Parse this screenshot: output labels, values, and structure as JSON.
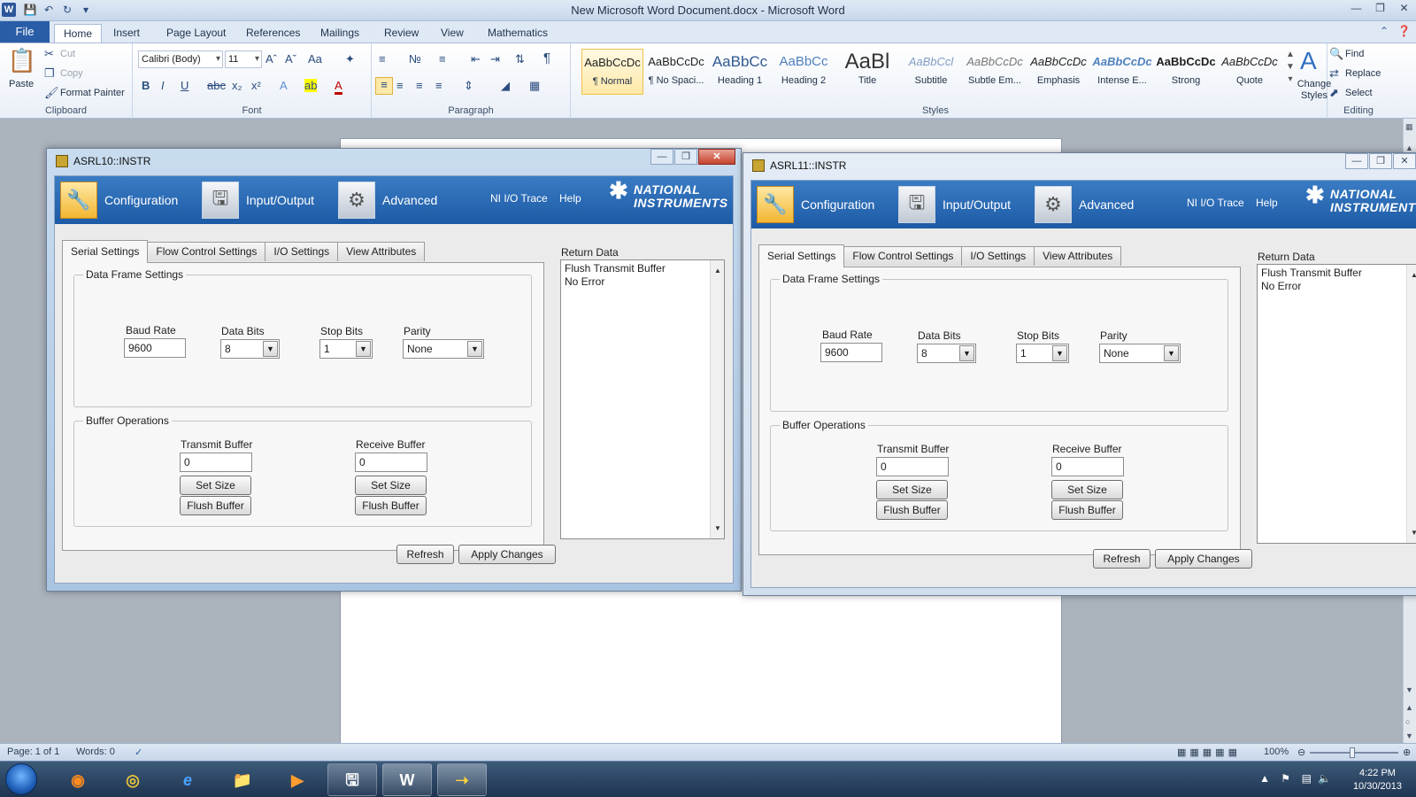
{
  "word": {
    "title": "New Microsoft Word Document.docx - Microsoft Word",
    "tabs": [
      "File",
      "Home",
      "Insert",
      "Page Layout",
      "References",
      "Mailings",
      "Review",
      "View",
      "Mathematics"
    ],
    "clipboard": {
      "paste": "Paste",
      "cut": "Cut",
      "copy": "Copy",
      "format_painter": "Format Painter",
      "label": "Clipboard"
    },
    "font": {
      "name": "Calibri (Body)",
      "size": "11",
      "label": "Font"
    },
    "paragraph": {
      "label": "Paragraph"
    },
    "styles": {
      "label": "Styles",
      "items": [
        {
          "preview": "AaBbCcDc",
          "name": "¶ Normal"
        },
        {
          "preview": "AaBbCcDc",
          "name": "¶ No Spaci..."
        },
        {
          "preview": "AaBbCc",
          "name": "Heading 1"
        },
        {
          "preview": "AaBbCc",
          "name": "Heading 2"
        },
        {
          "preview": "AaBl",
          "name": "Title"
        },
        {
          "preview": "AaBbCcl",
          "name": "Subtitle"
        },
        {
          "preview": "AaBbCcDc",
          "name": "Subtle Em..."
        },
        {
          "preview": "AaBbCcDc",
          "name": "Emphasis"
        },
        {
          "preview": "AaBbCcDc",
          "name": "Intense E..."
        },
        {
          "preview": "AaBbCcDc",
          "name": "Strong"
        },
        {
          "preview": "AaBbCcDc",
          "name": "Quote"
        }
      ],
      "change_styles": "Change Styles"
    },
    "editing": {
      "find": "Find",
      "replace": "Replace",
      "select": "Select",
      "label": "Editing"
    },
    "status": {
      "page": "Page: 1 of 1",
      "words": "Words: 0",
      "zoom": "100%"
    }
  },
  "taskbar": {
    "time": "4:22 PM",
    "date": "10/30/2013"
  },
  "ni_windows": [
    {
      "title": "ASRL10::INSTR",
      "nav": {
        "configuration": "Configuration",
        "io": "Input/Output",
        "advanced": "Advanced",
        "trace": "NI I/O Trace",
        "help": "Help",
        "logo1": "NATIONAL",
        "logo2": "INSTRUMENTS"
      },
      "tabs": [
        "Serial Settings",
        "Flow Control Settings",
        "I/O Settings",
        "View Attributes"
      ],
      "data_frame": {
        "legend": "Data Frame Settings",
        "baud_label": "Baud Rate",
        "baud": "9600",
        "bits_label": "Data Bits",
        "bits": "8",
        "stop_label": "Stop Bits",
        "stop": "1",
        "parity_label": "Parity",
        "parity": "None"
      },
      "buffer": {
        "legend": "Buffer Operations",
        "tx_label": "Transmit Buffer",
        "tx": "0",
        "rx_label": "Receive Buffer",
        "rx": "0",
        "set_size": "Set Size",
        "flush": "Flush Buffer"
      },
      "return": {
        "label": "Return Data",
        "lines": [
          "Flush Transmit Buffer",
          "No Error"
        ]
      },
      "refresh": "Refresh",
      "apply": "Apply Changes"
    },
    {
      "title": "ASRL11::INSTR",
      "nav": {
        "configuration": "Configuration",
        "io": "Input/Output",
        "advanced": "Advanced",
        "trace": "NI I/O Trace",
        "help": "Help",
        "logo1": "NATIONAL",
        "logo2": "INSTRUMENT"
      },
      "tabs": [
        "Serial Settings",
        "Flow Control Settings",
        "I/O Settings",
        "View Attributes"
      ],
      "data_frame": {
        "legend": "Data Frame Settings",
        "baud_label": "Baud Rate",
        "baud": "9600",
        "bits_label": "Data Bits",
        "bits": "8",
        "stop_label": "Stop Bits",
        "stop": "1",
        "parity_label": "Parity",
        "parity": "None"
      },
      "buffer": {
        "legend": "Buffer Operations",
        "tx_label": "Transmit Buffer",
        "tx": "0",
        "rx_label": "Receive Buffer",
        "rx": "0",
        "set_size": "Set Size",
        "flush": "Flush Buffer"
      },
      "return": {
        "label": "Return Data",
        "lines": [
          "Flush Transmit Buffer",
          "No Error"
        ]
      },
      "refresh": "Refresh",
      "apply": "Apply Changes"
    }
  ]
}
